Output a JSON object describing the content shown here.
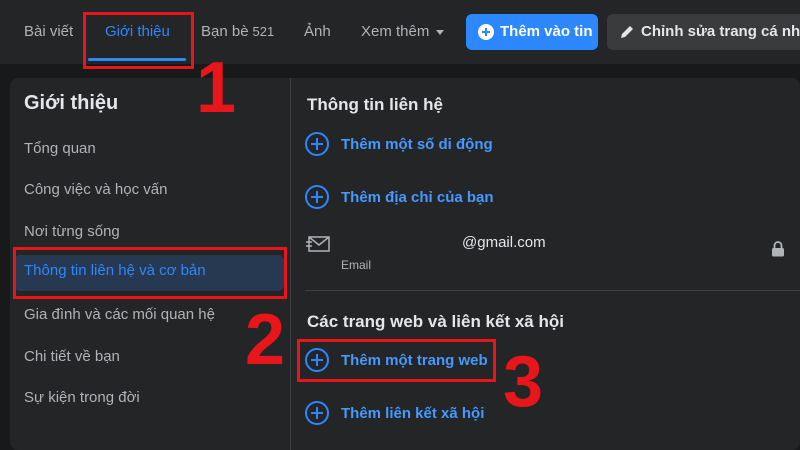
{
  "nav": {
    "tabs": [
      {
        "label": "Bài viết"
      },
      {
        "label": "Giới thiệu",
        "active": true
      },
      {
        "label": "Bạn bè",
        "count": "521"
      },
      {
        "label": "Ảnh"
      },
      {
        "label": "Xem thêm"
      }
    ],
    "add_story_label": "Thêm vào tin",
    "edit_profile_label": "Chỉnh sửa trang cá nhân"
  },
  "sidebar": {
    "title": "Giới thiệu",
    "items": [
      {
        "label": "Tổng quan"
      },
      {
        "label": "Công việc và học vấn"
      },
      {
        "label": "Nơi từng sống"
      },
      {
        "label": "Thông tin liên hệ và cơ bản",
        "active": true
      },
      {
        "label": "Gia đình và các mối quan hệ"
      },
      {
        "label": "Chi tiết về bạn"
      },
      {
        "label": "Sự kiện trong đời"
      }
    ]
  },
  "contact": {
    "title": "Thông tin liên hệ",
    "add_phone": "Thêm một số di động",
    "add_address": "Thêm địa chỉ của bạn",
    "email_value": "@gmail.com",
    "email_type": "Email"
  },
  "websites": {
    "title": "Các trang web và liên kết xã hội",
    "add_website": "Thêm một trang web",
    "add_social": "Thêm liên kết xã hội"
  },
  "annotations": {
    "step1": "1",
    "step2": "2",
    "step3": "3",
    "color": "#e8161a"
  },
  "colors": {
    "accent": "#2d88ff",
    "background": "#18191a",
    "surface": "#242526"
  },
  "icons": [
    "plus-circle-icon",
    "envelope-icon",
    "lock-icon",
    "pencil-icon",
    "caret-down-icon"
  ]
}
